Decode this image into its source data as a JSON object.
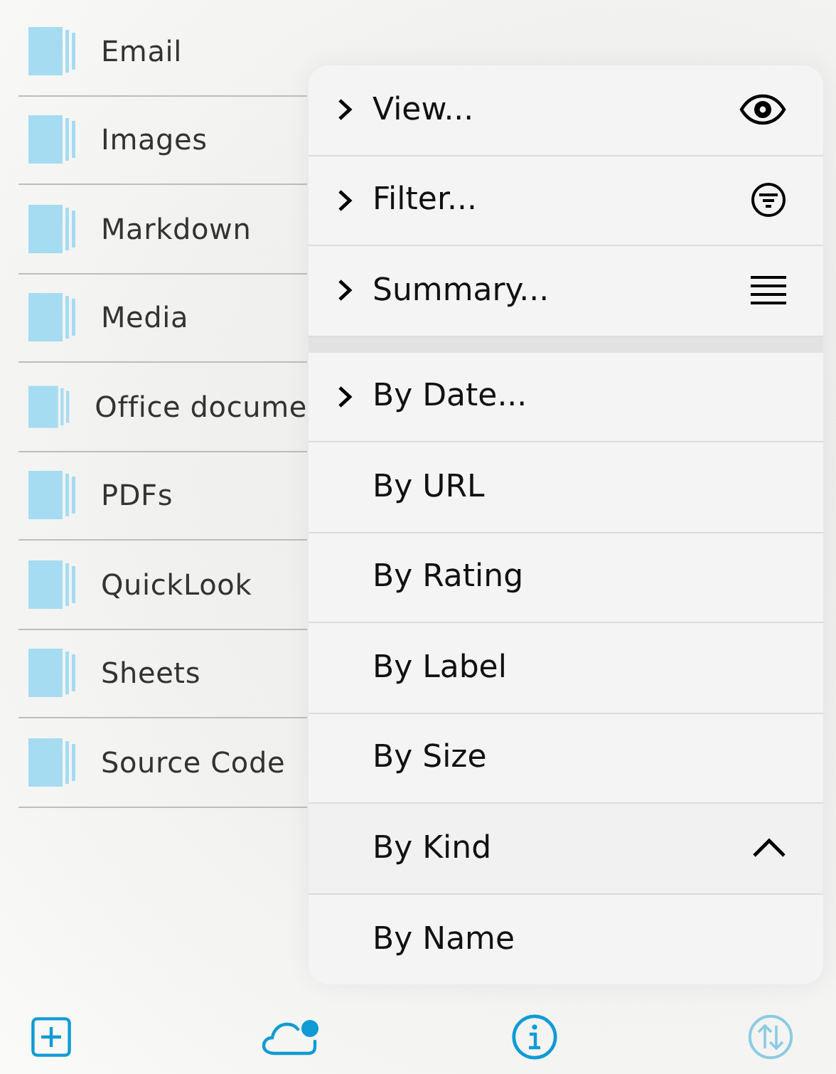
{
  "sidebar": {
    "items": [
      {
        "label": "Email"
      },
      {
        "label": "Images"
      },
      {
        "label": "Markdown"
      },
      {
        "label": "Media"
      },
      {
        "label": "Office docume"
      },
      {
        "label": "PDFs"
      },
      {
        "label": "QuickLook"
      },
      {
        "label": "Sheets"
      },
      {
        "label": "Source Code"
      }
    ]
  },
  "menu": {
    "groups": [
      [
        {
          "label": "View...",
          "submenu": true,
          "selected": false
        },
        {
          "label": "Filter...",
          "submenu": true,
          "selected": false
        },
        {
          "label": "Summary...",
          "submenu": true,
          "selected": false
        }
      ],
      [
        {
          "label": "By Date...",
          "submenu": true,
          "selected": false
        },
        {
          "label": "By URL",
          "submenu": false,
          "selected": false
        },
        {
          "label": "By Rating",
          "submenu": false,
          "selected": false
        },
        {
          "label": "By Label",
          "submenu": false,
          "selected": false
        },
        {
          "label": "By Size",
          "submenu": false,
          "selected": false
        },
        {
          "label": "By Kind",
          "submenu": false,
          "selected": true
        },
        {
          "label": "By Name",
          "submenu": false,
          "selected": false
        }
      ]
    ]
  },
  "toolbar": [
    {
      "kind": "add",
      "disabled": false
    },
    {
      "kind": "cloud",
      "disabled": false,
      "badge": true
    },
    {
      "kind": "info",
      "disabled": false
    },
    {
      "kind": "sort",
      "disabled": true
    }
  ]
}
